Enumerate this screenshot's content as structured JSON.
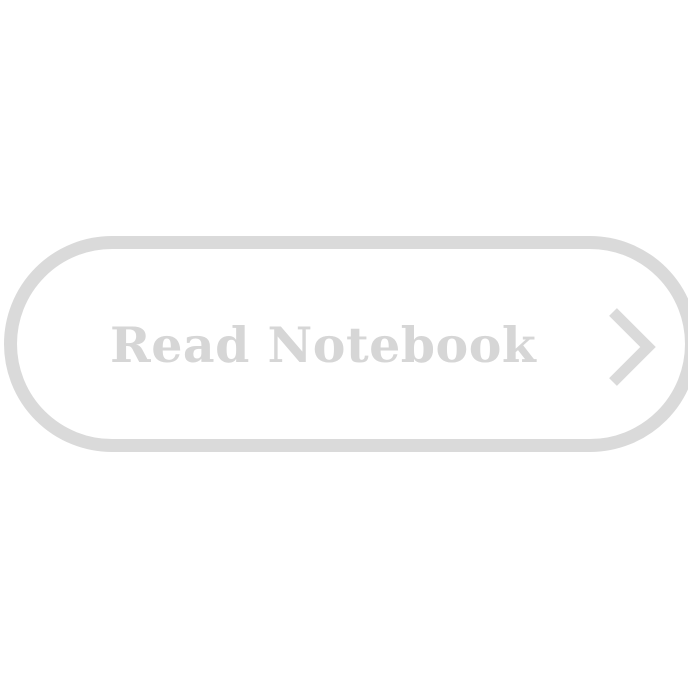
{
  "button": {
    "label": "Read Notebook",
    "icon": "chevron-right-icon"
  },
  "colors": {
    "background": "#ffffff",
    "outline": "#dadada",
    "label": "#d6d6d6",
    "icon": "#dadada"
  }
}
